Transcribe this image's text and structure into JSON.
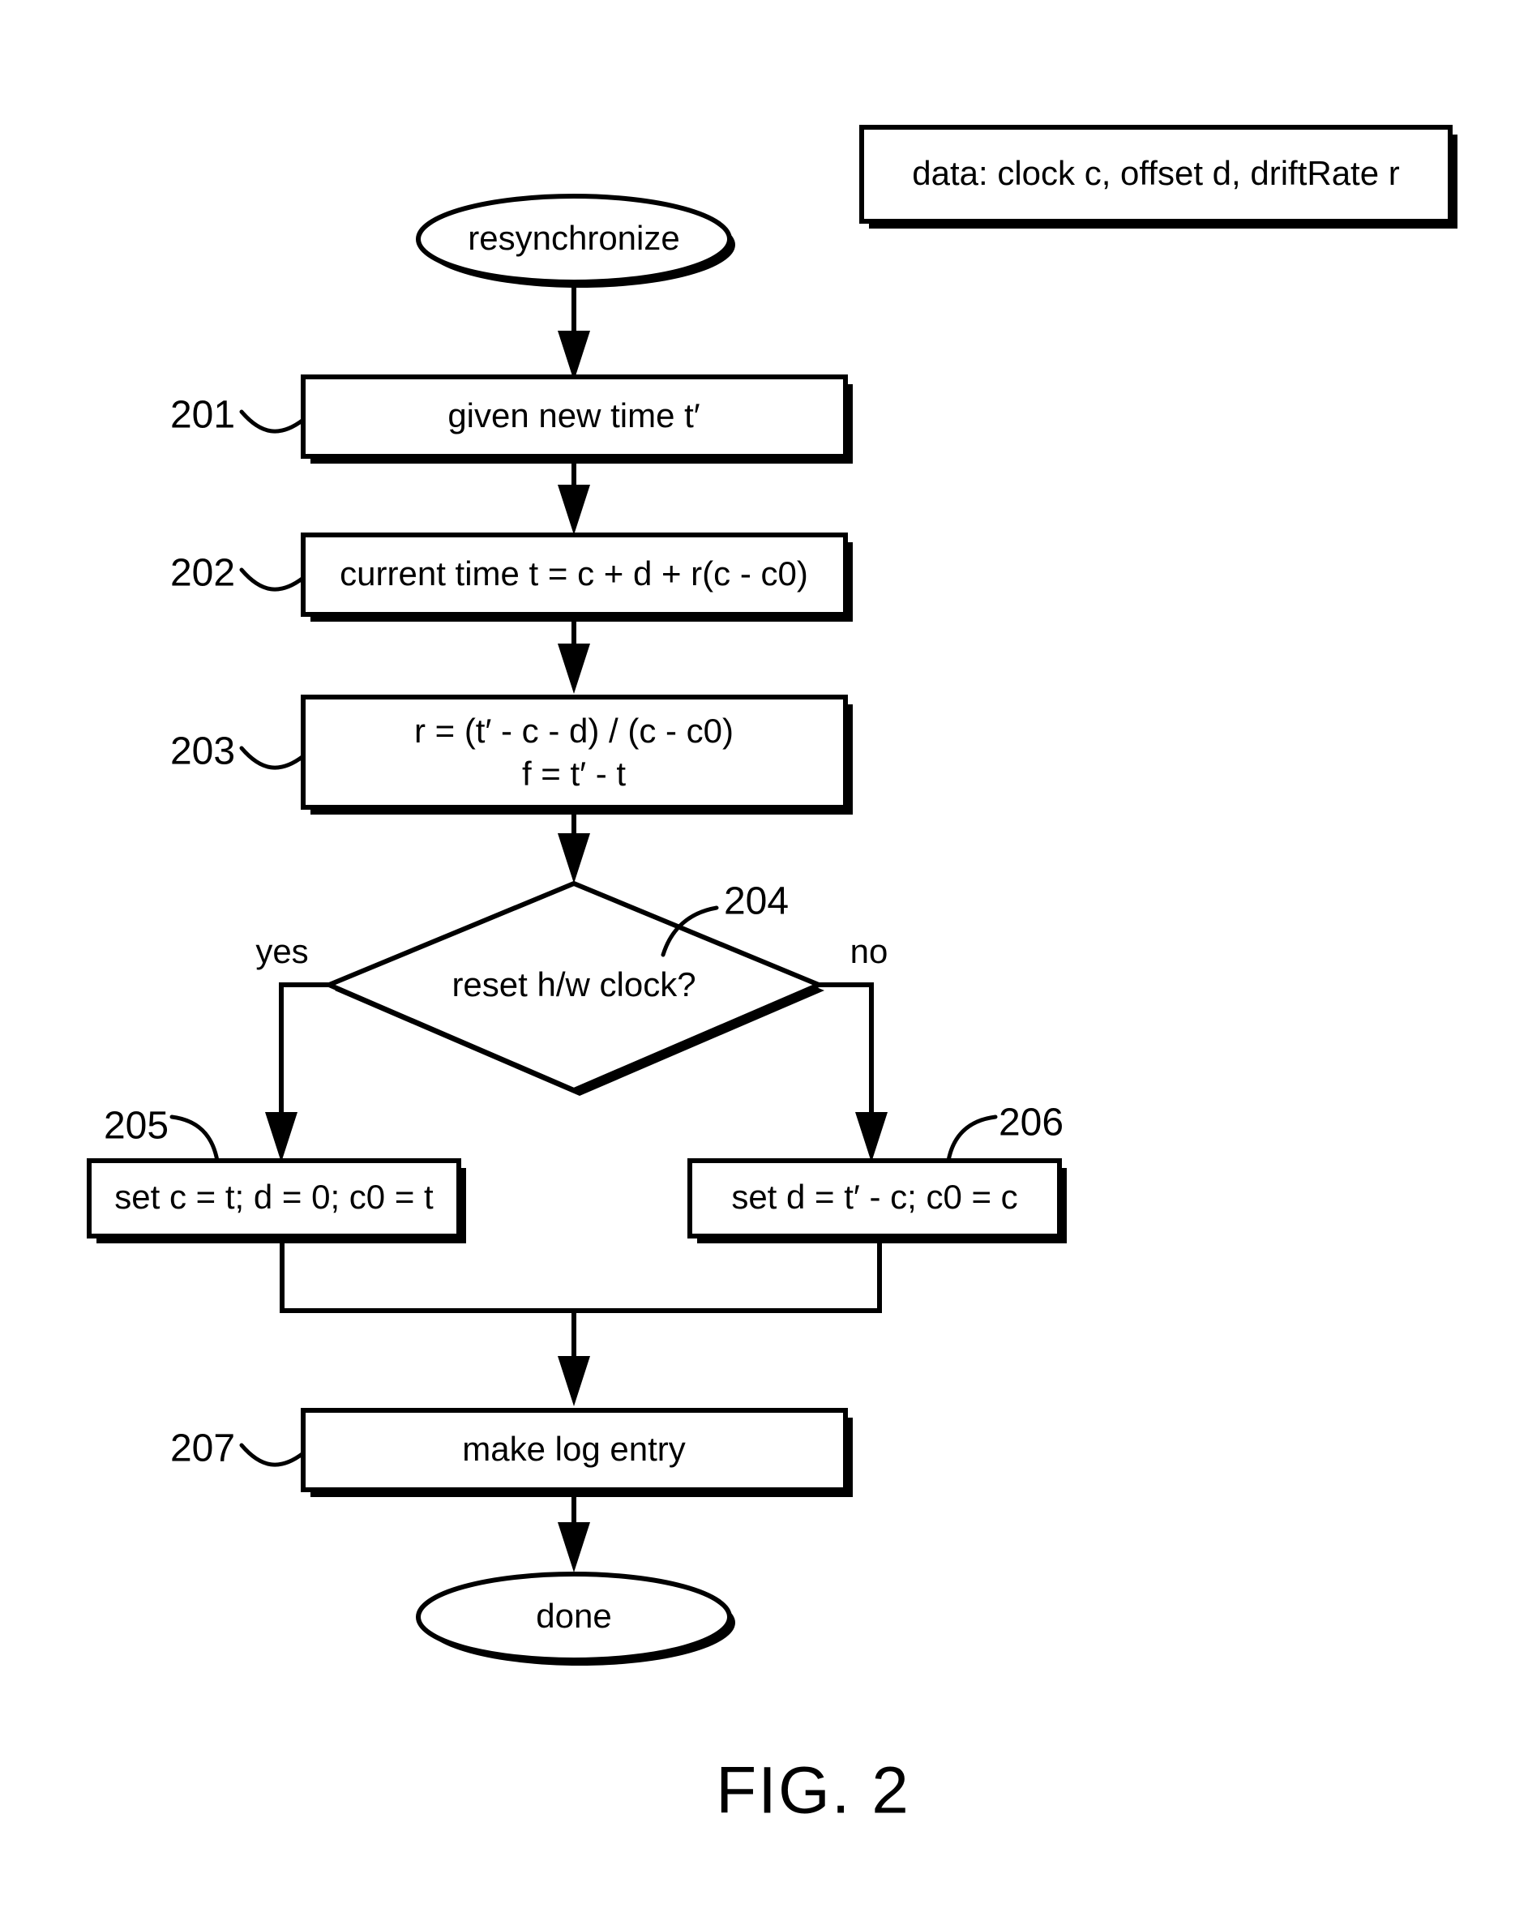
{
  "figure": {
    "caption": "FIG. 2",
    "data_note": "data: clock c, offset d, driftRate r"
  },
  "nodes": {
    "start": {
      "label": "resynchronize",
      "shape": "ellipse"
    },
    "step201": {
      "ref": "201",
      "label": "given new time t′",
      "shape": "process"
    },
    "step202": {
      "ref": "202",
      "label": "current time t = c + d + r(c - c0)",
      "shape": "process"
    },
    "step203": {
      "ref": "203",
      "line1": "r = (t′ - c - d) / (c - c0)",
      "line2": "f = t′ - t",
      "shape": "process"
    },
    "decision204": {
      "ref": "204",
      "label": "reset h/w clock?",
      "shape": "diamond",
      "branch_yes": "yes",
      "branch_no": "no"
    },
    "step205": {
      "ref": "205",
      "label": "set c = t; d = 0; c0 = t",
      "shape": "process"
    },
    "step206": {
      "ref": "206",
      "label": "set d = t′ - c; c0 = c",
      "shape": "process"
    },
    "step207": {
      "ref": "207",
      "label": "make log entry",
      "shape": "process"
    },
    "end": {
      "label": "done",
      "shape": "ellipse"
    }
  },
  "colors": {
    "ink": "#000000",
    "paper": "#ffffff"
  }
}
